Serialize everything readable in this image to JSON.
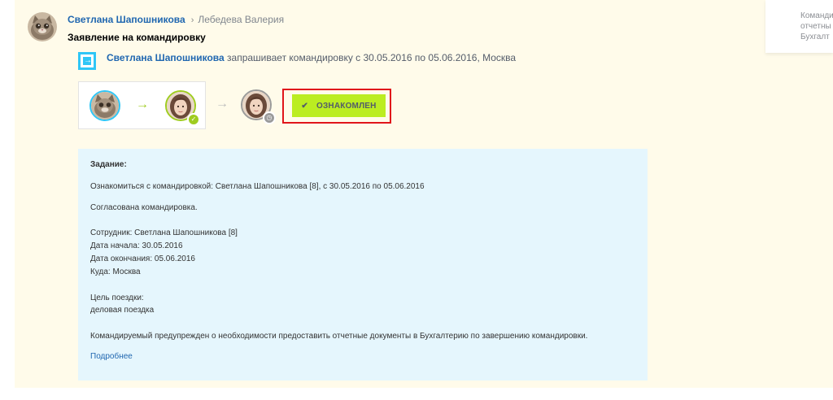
{
  "post": {
    "author": "Светлана Шапошникова",
    "separator": "›",
    "recipient": "Лебедева Валерия",
    "title": "Заявление на командировку"
  },
  "request": {
    "author": "Светлана Шапошникова",
    "text": "запрашивает командировку с 30.05.2016 по 05.06.2016, Москва",
    "icon": "arrow-right-square-icon"
  },
  "workflow": {
    "steps": [
      {
        "avatar": "cat-avatar",
        "status": "author"
      },
      {
        "avatar": "woman-avatar",
        "status": "approved"
      },
      {
        "avatar": "woman-avatar",
        "status": "pending"
      }
    ],
    "arrow_colors": [
      "#9fcc20",
      "#bdbdbd"
    ]
  },
  "ack_button": {
    "label": "ОЗНАКОМЛЕН",
    "icon": "check-icon",
    "color": "#bbed21"
  },
  "task": {
    "heading": "Задание:",
    "line1": "Ознакомиться с командировкой: Светлана Шапошникова [8], с 30.05.2016 по 05.06.2016",
    "line2": "Согласована командировка.",
    "employee": "Сотрудник: Светлана Шапошникова [8]",
    "start": "Дата начала: 30.05.2016",
    "end": "Дата окончания: 05.06.2016",
    "destination": "Куда: Москва",
    "purpose_label": "Цель поездки:",
    "purpose": "деловая поездка",
    "notice": "Командируемый предупрежден о необходимости предоставить отчетные документы в Бухгалтерию по завершению командировки.",
    "more": "Подробнее"
  },
  "side_panel": {
    "lines": [
      "Команди",
      "отчетны",
      "Бухгалт"
    ]
  },
  "colors": {
    "link": "#2067b0",
    "post_bg": "#fffbea",
    "task_bg": "#e5f6fd",
    "highlight": "#e0151b"
  }
}
